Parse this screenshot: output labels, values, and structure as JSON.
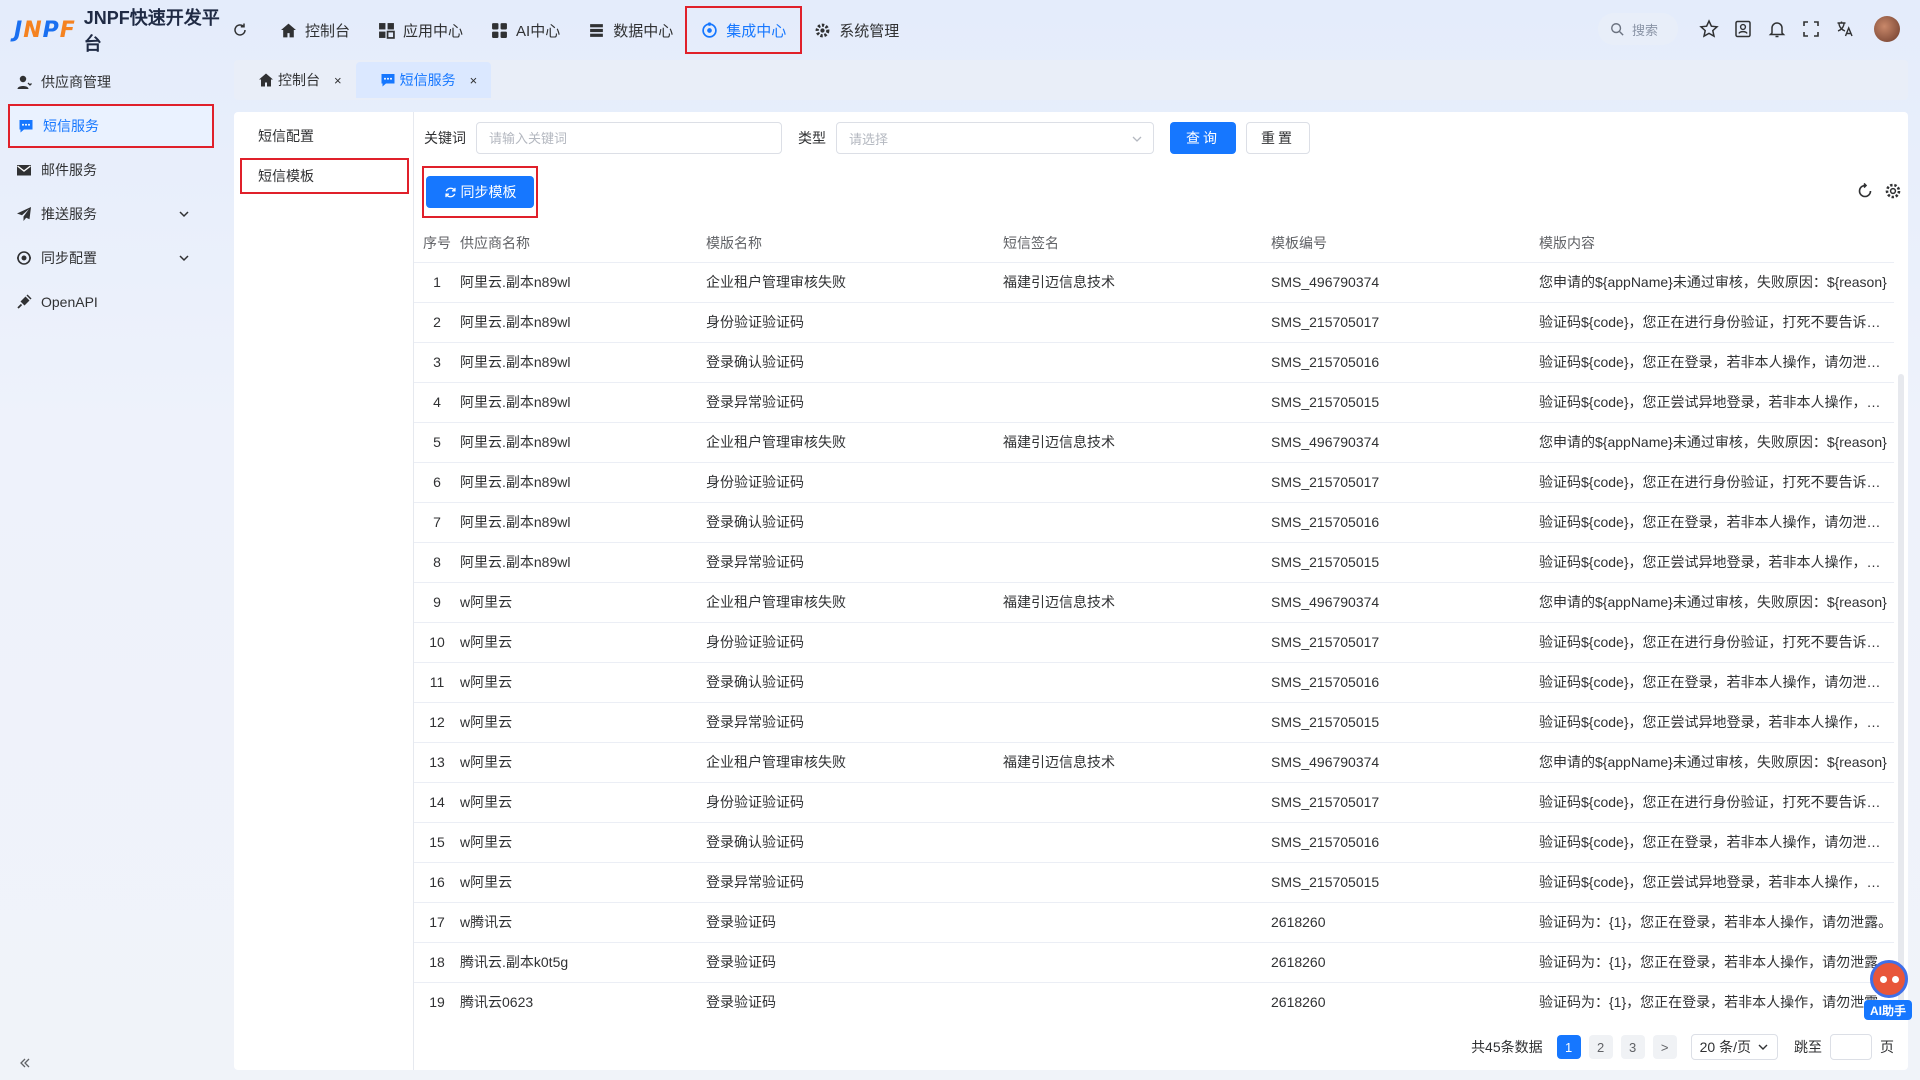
{
  "app": {
    "logo_mark": "JNPF",
    "title": "JNPF快速开发平台"
  },
  "topnav": [
    {
      "label": "控制台",
      "icon": "home-icon"
    },
    {
      "label": "应用中心",
      "icon": "grid-icon"
    },
    {
      "label": "AI中心",
      "icon": "apps-icon"
    },
    {
      "label": "数据中心",
      "icon": "database-icon"
    },
    {
      "label": "集成中心",
      "icon": "integration-icon",
      "active": true
    },
    {
      "label": "系统管理",
      "icon": "gear-icon"
    }
  ],
  "top_search": {
    "placeholder": "搜索"
  },
  "sidebar": [
    {
      "label": "供应商管理",
      "icon": "user-icon"
    },
    {
      "label": "短信服务",
      "icon": "message-icon",
      "active": true
    },
    {
      "label": "邮件服务",
      "icon": "mail-icon"
    },
    {
      "label": "推送服务",
      "icon": "send-icon",
      "expandable": true
    },
    {
      "label": "同步配置",
      "icon": "sync-config-icon",
      "expandable": true
    },
    {
      "label": "OpenAPI",
      "icon": "api-icon"
    }
  ],
  "page_tabs": [
    {
      "label": "控制台",
      "icon": "home-icon",
      "close": "×"
    },
    {
      "label": "短信服务",
      "icon": "message-icon",
      "close": "×",
      "active": true
    }
  ],
  "subnav": [
    {
      "label": "短信配置"
    },
    {
      "label": "短信模板",
      "selected": true
    }
  ],
  "filter": {
    "keyword_label": "关键词",
    "keyword_placeholder": "请输入关键词",
    "type_label": "类型",
    "type_placeholder": "请选择",
    "query_button": "查询",
    "reset_button": "重置"
  },
  "toolbar": {
    "sync_button": "同步模板"
  },
  "table": {
    "columns": [
      "序号",
      "供应商名称",
      "模版名称",
      "短信签名",
      "模板编号",
      "模版内容"
    ],
    "rows": [
      [
        "1",
        "阿里云.副本n89wl",
        "企业租户管理审核失败",
        "福建引迈信息技术",
        "SMS_496790374",
        "您申请的${appName}未通过审核，失败原因：${reason}"
      ],
      [
        "2",
        "阿里云.副本n89wl",
        "身份验证验证码",
        "",
        "SMS_215705017",
        "验证码${code}，您正在进行身份验证，打死不要告诉别人哦！"
      ],
      [
        "3",
        "阿里云.副本n89wl",
        "登录确认验证码",
        "",
        "SMS_215705016",
        "验证码${code}，您正在登录，若非本人操作，请勿泄露。"
      ],
      [
        "4",
        "阿里云.副本n89wl",
        "登录异常验证码",
        "",
        "SMS_215705015",
        "验证码${code}，您正尝试异地登录，若非本人操作，请勿泄露。"
      ],
      [
        "5",
        "阿里云.副本n89wl",
        "企业租户管理审核失败",
        "福建引迈信息技术",
        "SMS_496790374",
        "您申请的${appName}未通过审核，失败原因：${reason}"
      ],
      [
        "6",
        "阿里云.副本n89wl",
        "身份验证验证码",
        "",
        "SMS_215705017",
        "验证码${code}，您正在进行身份验证，打死不要告诉别人哦！"
      ],
      [
        "7",
        "阿里云.副本n89wl",
        "登录确认验证码",
        "",
        "SMS_215705016",
        "验证码${code}，您正在登录，若非本人操作，请勿泄露。"
      ],
      [
        "8",
        "阿里云.副本n89wl",
        "登录异常验证码",
        "",
        "SMS_215705015",
        "验证码${code}，您正尝试异地登录，若非本人操作，请勿泄露。"
      ],
      [
        "9",
        "w阿里云",
        "企业租户管理审核失败",
        "福建引迈信息技术",
        "SMS_496790374",
        "您申请的${appName}未通过审核，失败原因：${reason}"
      ],
      [
        "10",
        "w阿里云",
        "身份验证验证码",
        "",
        "SMS_215705017",
        "验证码${code}，您正在进行身份验证，打死不要告诉别人哦！"
      ],
      [
        "11",
        "w阿里云",
        "登录确认验证码",
        "",
        "SMS_215705016",
        "验证码${code}，您正在登录，若非本人操作，请勿泄露。"
      ],
      [
        "12",
        "w阿里云",
        "登录异常验证码",
        "",
        "SMS_215705015",
        "验证码${code}，您正尝试异地登录，若非本人操作，请勿泄露。"
      ],
      [
        "13",
        "w阿里云",
        "企业租户管理审核失败",
        "福建引迈信息技术",
        "SMS_496790374",
        "您申请的${appName}未通过审核，失败原因：${reason}"
      ],
      [
        "14",
        "w阿里云",
        "身份验证验证码",
        "",
        "SMS_215705017",
        "验证码${code}，您正在进行身份验证，打死不要告诉别人哦！"
      ],
      [
        "15",
        "w阿里云",
        "登录确认验证码",
        "",
        "SMS_215705016",
        "验证码${code}，您正在登录，若非本人操作，请勿泄露。"
      ],
      [
        "16",
        "w阿里云",
        "登录异常验证码",
        "",
        "SMS_215705015",
        "验证码${code}，您正尝试异地登录，若非本人操作，请勿泄露。"
      ],
      [
        "17",
        "w腾讯云",
        "登录验证码",
        "",
        "2618260",
        "验证码为：{1}，您正在登录，若非本人操作，请勿泄露。"
      ],
      [
        "18",
        "腾讯云.副本k0t5g",
        "登录验证码",
        "",
        "2618260",
        "验证码为：{1}，您正在登录，若非本人操作，请勿泄露。"
      ],
      [
        "19",
        "腾讯云0623",
        "登录验证码",
        "",
        "2618260",
        "验证码为：{1}，您正在登录，若非本人操作，请勿泄露。"
      ]
    ]
  },
  "pagination": {
    "total_text": "共45条数据",
    "pages": [
      "1",
      "2",
      "3"
    ],
    "current": "1",
    "next": ">",
    "page_size": "20 条/页",
    "jump_label": "跳至",
    "page_suffix": "页"
  },
  "ai_assistant": {
    "label": "AI助手"
  },
  "colors": {
    "accent": "#1677ff",
    "highlight_box": "#e0202a",
    "logo_orange": "#f58220"
  }
}
